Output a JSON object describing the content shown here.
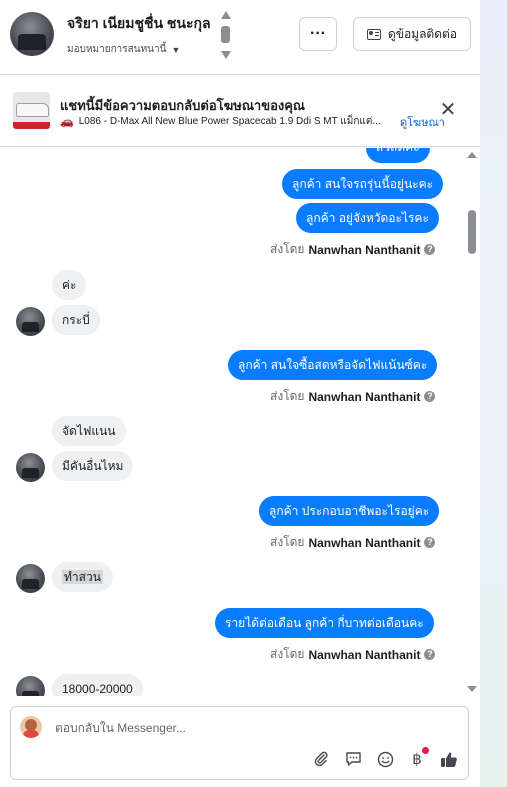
{
  "header": {
    "name": "จริยา เนียมชูชื่น ชนะกุล",
    "assigned": "มอบหมายการสนทนานี้",
    "more_label": "···",
    "contact_label": "ดูข้อมูลติดต่อ"
  },
  "ad": {
    "title": "แชทนี้มีข้อความตอบกลับต่อโฆษณาของคุณ",
    "subtitle": "L086 - D-Max All New Blue Power Spacecab 1.9 Ddi S MT แม็กแต่...",
    "link": "ดูโฆษณา",
    "close": "✕"
  },
  "messages": {
    "m1": "สวัสดีค่ะ",
    "m2": "ลูกค้า สนใจรถรุ่นนี้อยู่นะคะ",
    "m3": "ลูกค้า อยู่จังหวัดอะไรคะ",
    "sent_prefix": "ส่งโดย",
    "sender": "Nanwhan Nanthanit",
    "m4": "ค่ะ",
    "m5": "กระบี่",
    "m6": "ลูกค้า สนใจซื้อสดหรือจัดไฟแน้นซ์คะ",
    "m7": "จัดไฟแนน",
    "m8": "มีคันอื่นไหม",
    "m9": "ลูกค้า ประกอบอาชีพอะไรอยู่คะ",
    "m10": "ทำสวน",
    "m11": "รายได้ต่อเดือน  ลูกค้า กี่บาทต่อเดือนคะ",
    "m12": "18000-20000"
  },
  "composer": {
    "placeholder": "ตอบกลับใน Messenger..."
  },
  "icons": {
    "attach": "paperclip-icon",
    "saved_reply": "chat-bubble-icon",
    "emoji": "smile-icon",
    "currency": "baht-icon",
    "like": "thumbs-up-icon"
  },
  "colors": {
    "outgoing_bubble": "#0a7cff",
    "incoming_bubble": "#eef0f2",
    "link": "#0064d1"
  }
}
